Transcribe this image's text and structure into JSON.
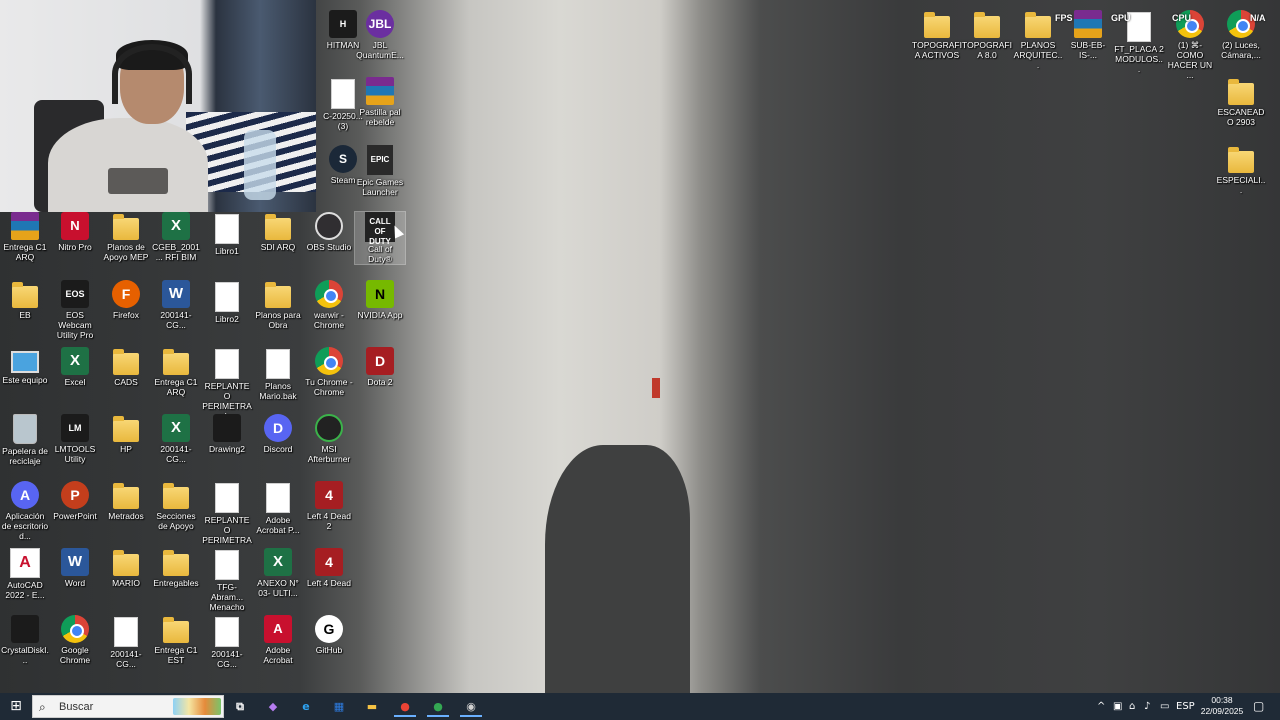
{
  "desktop": {
    "icons": [
      {
        "label": "HITMAN",
        "glyph": "dark",
        "text": "H"
      },
      {
        "label": "JBL QuantumE...",
        "glyph": "jbl",
        "text": "JBL"
      },
      {
        "label": "C-20250... (3)",
        "glyph": "doc",
        "text": ""
      },
      {
        "label": "Pastilla pal rebelde",
        "glyph": "winrar",
        "text": ""
      },
      {
        "label": "Steam",
        "glyph": "steam",
        "text": "S"
      },
      {
        "label": "Epic Games Launcher",
        "glyph": "epic",
        "text": "EPIC"
      },
      {
        "label": "Entrega C1 ARQ",
        "glyph": "winrar",
        "text": ""
      },
      {
        "label": "Nitro Pro",
        "glyph": "pdf",
        "text": "N"
      },
      {
        "label": "Planos de Apoyo MEP",
        "glyph": "folder",
        "text": ""
      },
      {
        "label": "CGEB_2001... RFI BIM",
        "glyph": "excel",
        "text": "X"
      },
      {
        "label": "Libro1",
        "glyph": "doc",
        "text": ""
      },
      {
        "label": "SDI ARQ",
        "glyph": "folder",
        "text": ""
      },
      {
        "label": "OBS Studio",
        "glyph": "obs",
        "text": ""
      },
      {
        "label": "Call of Duty®",
        "glyph": "cod",
        "text": "CALL OF DUTY"
      },
      {
        "label": "EB",
        "glyph": "folder",
        "text": ""
      },
      {
        "label": "EOS Webcam Utility Pro",
        "glyph": "dark",
        "text": "EOS"
      },
      {
        "label": "Firefox",
        "glyph": "orange",
        "text": "F"
      },
      {
        "label": "200141-CG...",
        "glyph": "word",
        "text": "W"
      },
      {
        "label": "Libro2",
        "glyph": "doc",
        "text": ""
      },
      {
        "label": "Planos para Obra",
        "glyph": "folder",
        "text": ""
      },
      {
        "label": "warwir - Chrome",
        "glyph": "chrome",
        "text": ""
      },
      {
        "label": "NVIDIA App",
        "glyph": "green",
        "text": "N"
      },
      {
        "label": "Este equipo",
        "glyph": "pc",
        "text": ""
      },
      {
        "label": "Excel",
        "glyph": "excel",
        "text": "X"
      },
      {
        "label": "CADS",
        "glyph": "folder",
        "text": ""
      },
      {
        "label": "Entrega C1 ARQ",
        "glyph": "folder",
        "text": ""
      },
      {
        "label": "REPLANTEO PERIMETRAL",
        "glyph": "doc",
        "text": ""
      },
      {
        "label": "Planos Mario.bak",
        "glyph": "doc",
        "text": ""
      },
      {
        "label": "Tu Chrome - Chrome",
        "glyph": "chrome",
        "text": ""
      },
      {
        "label": "Dota 2",
        "glyph": "red",
        "text": "D"
      },
      {
        "label": "Papelera de reciclaje",
        "glyph": "bin",
        "text": ""
      },
      {
        "label": "LMTOOLS Utility",
        "glyph": "dark",
        "text": "LM"
      },
      {
        "label": "HP",
        "glyph": "folder",
        "text": ""
      },
      {
        "label": "200141-CG...",
        "glyph": "excel",
        "text": "X"
      },
      {
        "label": "Drawing2",
        "glyph": "dark",
        "text": ""
      },
      {
        "label": "Discord",
        "glyph": "blue",
        "text": "D"
      },
      {
        "label": "MSI Afterburner",
        "glyph": "msi",
        "text": ""
      },
      {
        "label": "Aplicación de escritorio d...",
        "glyph": "blue",
        "text": "A"
      },
      {
        "label": "PowerPoint",
        "glyph": "ppt",
        "text": "P"
      },
      {
        "label": "Metrados",
        "glyph": "folder",
        "text": ""
      },
      {
        "label": "Secciones de Apoyo",
        "glyph": "folder",
        "text": ""
      },
      {
        "label": "REPLANTEO PERIMETRA...",
        "glyph": "doc",
        "text": ""
      },
      {
        "label": "Adobe Acrobat P...",
        "glyph": "doc",
        "text": ""
      },
      {
        "label": "Left 4 Dead 2",
        "glyph": "red",
        "text": "4"
      },
      {
        "label": "AutoCAD 2022 - E...",
        "glyph": "autocad",
        "text": "A"
      },
      {
        "label": "Word",
        "glyph": "word",
        "text": "W"
      },
      {
        "label": "MARIO",
        "glyph": "folder",
        "text": ""
      },
      {
        "label": "Entregables",
        "glyph": "folder",
        "text": ""
      },
      {
        "label": "TFG-Abram... Menacho",
        "glyph": "doc",
        "text": ""
      },
      {
        "label": "ANEXO N° 03- ULTI...",
        "glyph": "excel",
        "text": "X"
      },
      {
        "label": "Left 4 Dead",
        "glyph": "red",
        "text": "4"
      },
      {
        "label": "CrystalDiskI...",
        "glyph": "dark",
        "text": ""
      },
      {
        "label": "Google Chrome",
        "glyph": "chrome",
        "text": ""
      },
      {
        "label": "200141-CG...",
        "glyph": "doc",
        "text": ""
      },
      {
        "label": "Entrega C1 EST",
        "glyph": "folder",
        "text": ""
      },
      {
        "label": "200141-CG...",
        "glyph": "doc",
        "text": ""
      },
      {
        "label": "Adobe Acrobat",
        "glyph": "pdf",
        "text": "A"
      },
      {
        "label": "GitHub",
        "glyph": "github",
        "text": "G"
      },
      {
        "label": "TOPOGRAFIA ACTIVOS",
        "glyph": "folder",
        "text": ""
      },
      {
        "label": "TOPOGRAFIA 8.0",
        "glyph": "folder",
        "text": ""
      },
      {
        "label": "PLANOS ARQUITEC...",
        "glyph": "folder",
        "text": ""
      },
      {
        "label": "SUB-EB-IS-...",
        "glyph": "winrar",
        "text": ""
      },
      {
        "label": "FT_PLACA 2 MODULOS...",
        "glyph": "doc",
        "text": ""
      },
      {
        "label": "(1) ⌘-COMO HACER UN ...",
        "glyph": "chrome",
        "text": ""
      },
      {
        "label": "(2) Luces, Cámara,...",
        "glyph": "chrome",
        "text": ""
      },
      {
        "label": "ESCANEADO 2903",
        "glyph": "folder",
        "text": ""
      },
      {
        "label": "ESPECIALI...",
        "glyph": "folder",
        "text": ""
      }
    ]
  },
  "hud": {
    "fps": "FPS",
    "fps_value": "N/A",
    "gpu": "GPU",
    "gpu_value": "%",
    "cpu": "CPU",
    "cpu_value": "%",
    "last": "N/A"
  },
  "taskbar": {
    "start_icon": "windows-icon",
    "search_placeholder": "Buscar",
    "apps": [
      {
        "name": "task-view",
        "text": "⧉"
      },
      {
        "name": "copilot",
        "text": "◆"
      },
      {
        "name": "edge",
        "text": "e"
      },
      {
        "name": "store",
        "text": "▦"
      },
      {
        "name": "file-explorer",
        "text": "▬"
      },
      {
        "name": "chrome",
        "text": "●"
      },
      {
        "name": "chrome-profile",
        "text": "●"
      },
      {
        "name": "obs-studio",
        "text": "◉"
      }
    ],
    "tray": {
      "language": "ESP"
    },
    "clock": {
      "time": "00:38",
      "date": "22/09/2025"
    }
  }
}
